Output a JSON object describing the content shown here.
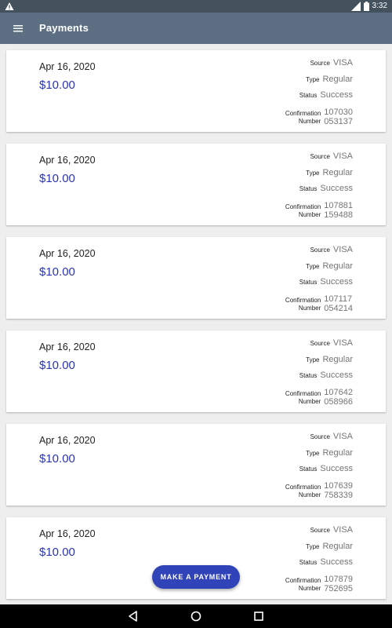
{
  "status_bar": {
    "time": "3:32",
    "network": "4G"
  },
  "app_bar": {
    "title": "Payments",
    "menu_icon": "hamburger-menu-icon"
  },
  "labels": {
    "source": "Source",
    "type": "Type",
    "status": "Status",
    "confirmation_line1": "Confirmation",
    "confirmation_line2": "Number"
  },
  "payments": [
    {
      "date": "Apr 16, 2020",
      "amount": "$10.00",
      "source": "VISA",
      "type": "Regular",
      "status": "Success",
      "confirmation_1": "107030",
      "confirmation_2": "053137"
    },
    {
      "date": "Apr 16, 2020",
      "amount": "$10.00",
      "source": "VISA",
      "type": "Regular",
      "status": "Success",
      "confirmation_1": "107881",
      "confirmation_2": "159488"
    },
    {
      "date": "Apr 16, 2020",
      "amount": "$10.00",
      "source": "VISA",
      "type": "Regular",
      "status": "Success",
      "confirmation_1": "107117",
      "confirmation_2": "054214"
    },
    {
      "date": "Apr 16, 2020",
      "amount": "$10.00",
      "source": "VISA",
      "type": "Regular",
      "status": "Success",
      "confirmation_1": "107642",
      "confirmation_2": "058966"
    },
    {
      "date": "Apr 16, 2020",
      "amount": "$10.00",
      "source": "VISA",
      "type": "Regular",
      "status": "Success",
      "confirmation_1": "107639",
      "confirmation_2": "758339"
    },
    {
      "date": "Apr 16, 2020",
      "amount": "$10.00",
      "source": "VISA",
      "type": "Regular",
      "status": "Success",
      "confirmation_1": "107879",
      "confirmation_2": "752695"
    }
  ],
  "fab": {
    "label": "MAKE A PAYMENT"
  },
  "colors": {
    "app_bar": "#5d7083",
    "status_bar": "#44525e",
    "amount": "#2b35b0",
    "fab": "#3143b8"
  }
}
